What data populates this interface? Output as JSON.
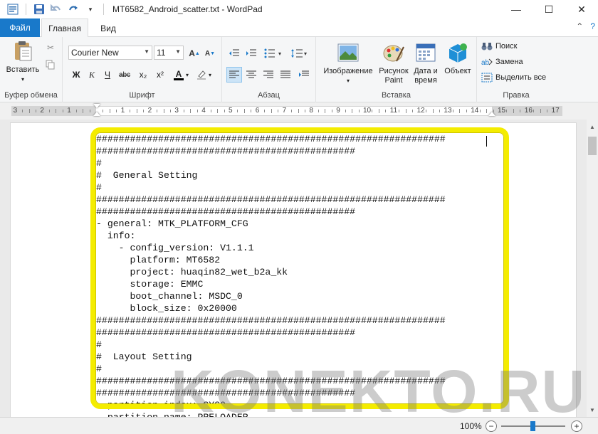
{
  "window": {
    "title": "MT6582_Android_scatter.txt - WordPad"
  },
  "tabs": {
    "file": "Файл",
    "home": "Главная",
    "view": "Вид"
  },
  "ribbon": {
    "clipboard": {
      "paste": "Вставить",
      "label": "Буфер обмена"
    },
    "font": {
      "family": "Courier New",
      "size": "11",
      "label": "Шрифт",
      "bold": "Ж",
      "italic": "К",
      "underline": "Ч",
      "strike": "abc",
      "sub": "x₂",
      "sup": "x²",
      "color_letter": "A"
    },
    "paragraph": {
      "label": "Абзац"
    },
    "insert": {
      "label": "Вставка",
      "image": "Изображение",
      "paint_line1": "Рисунок",
      "paint_line2": "Paint",
      "datetime_line1": "Дата и",
      "datetime_line2": "время",
      "object": "Объект"
    },
    "editing": {
      "label": "Правка",
      "find": "Поиск",
      "replace": "Замена",
      "select_all": "Выделить все"
    }
  },
  "ruler": {
    "numbers": [
      "3",
      "2",
      "1",
      "1",
      "2",
      "3",
      "4",
      "5",
      "6",
      "7",
      "8",
      "9",
      "10",
      "11",
      "12",
      "13",
      "14",
      "15",
      "16",
      "17"
    ]
  },
  "document": {
    "lines": [
      "##############################################################",
      "##############################################",
      "#",
      "#  General Setting",
      "#",
      "##############################################################",
      "##############################################",
      "- general: MTK_PLATFORM_CFG",
      "  info:",
      "    - config_version: V1.1.1",
      "      platform: MT6582",
      "      project: huaqin82_wet_b2a_kk",
      "      storage: EMMC",
      "      boot_channel: MSDC_0",
      "      block_size: 0x20000",
      "##############################################################",
      "##############################################",
      "#",
      "#  Layout Setting",
      "#",
      "##############################################################",
      "##############################################",
      "  partition_index: SYS0",
      "  partition_name: PRELOADER"
    ]
  },
  "watermark": "KONEKTO.RU",
  "statusbar": {
    "zoom": "100%",
    "zoom_out": "−",
    "zoom_in": "+"
  },
  "colors": {
    "accent": "#1979ca",
    "highlight": "#f4ec00"
  }
}
